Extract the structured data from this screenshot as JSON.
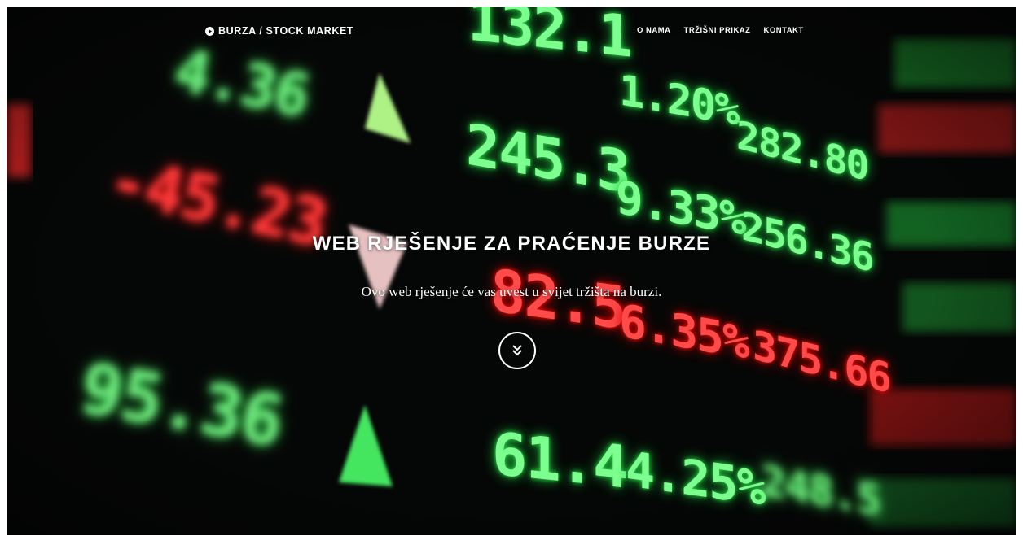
{
  "header": {
    "brand_label": "BURZA / STOCK MARKET",
    "brand_icon": "play-circle-icon",
    "nav": [
      {
        "label": "O NAMA"
      },
      {
        "label": "TRŽIŠNI PRIKAZ"
      },
      {
        "label": "KONTAKT"
      }
    ]
  },
  "hero": {
    "title": "WEB RJEŠENJE ZA PRAĆENJE BURZE",
    "subtitle": "Ovo web rješenje će vas uvest u svijet tržišta na burzi.",
    "scroll_icon": "double-chevron-down-icon"
  },
  "background": {
    "tickers": [
      "132.1",
      "4.36",
      "1.20%",
      "245.3",
      "282.80",
      "-45.23",
      "9.33%",
      "256.36",
      "82.5",
      "6.35%",
      "375.66",
      "95.36",
      "61.4",
      "4.25%",
      "248.5"
    ],
    "colors": {
      "up": "#7dff8f",
      "down": "#ff4a4a",
      "background": "#050706"
    }
  }
}
